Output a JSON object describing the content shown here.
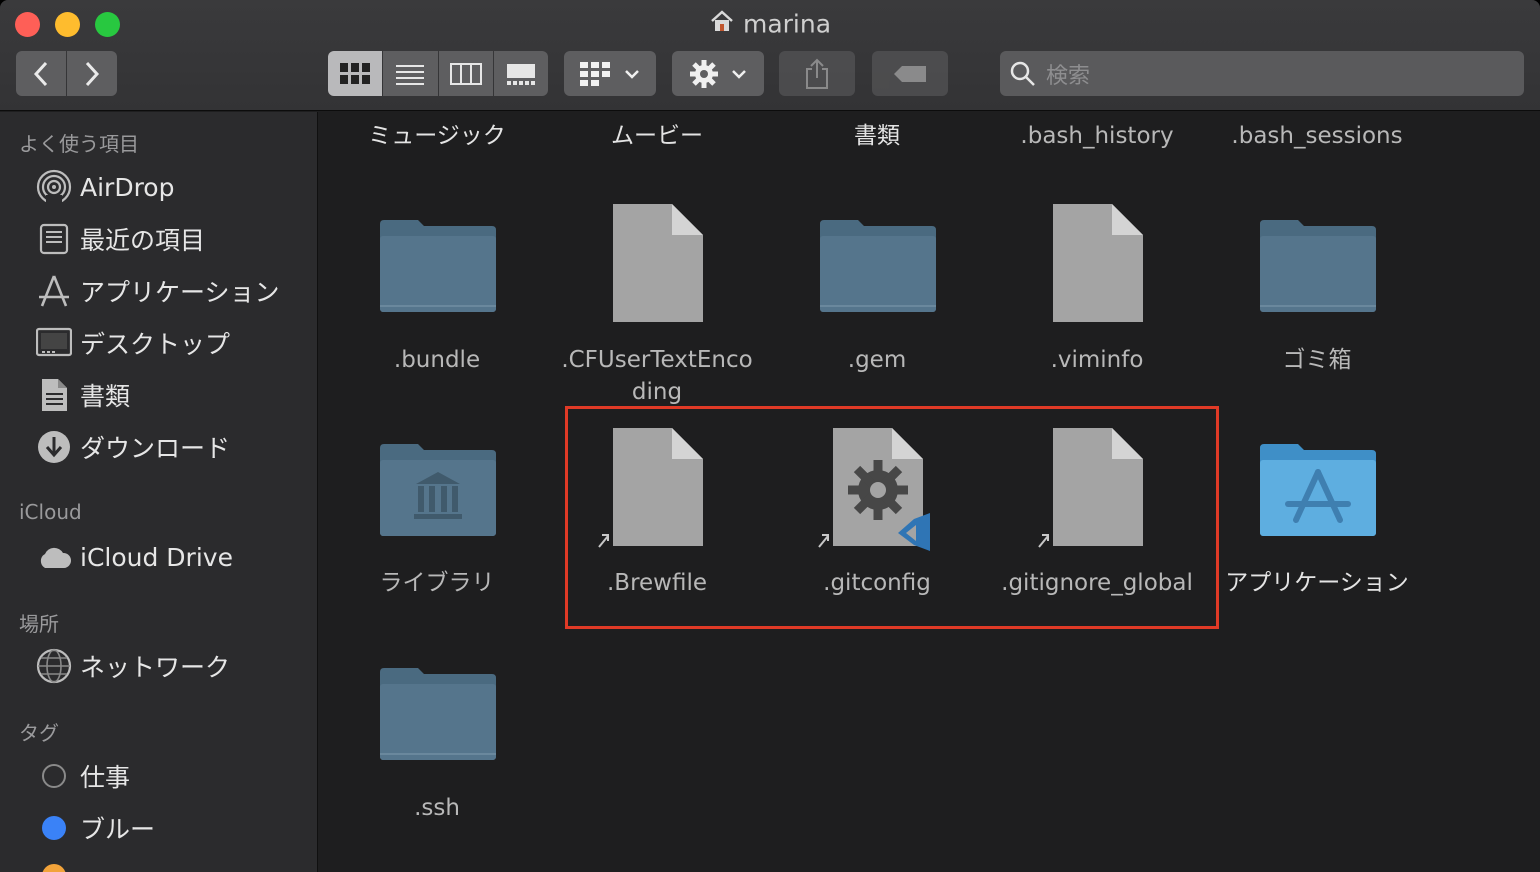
{
  "window": {
    "title": "marina"
  },
  "toolbar": {
    "search_placeholder": "検索"
  },
  "sidebar": {
    "favorites_heading": "よく使う項目",
    "favorites": [
      {
        "label": "AirDrop",
        "icon": "airdrop-icon"
      },
      {
        "label": "最近の項目",
        "icon": "recents-icon"
      },
      {
        "label": "アプリケーション",
        "icon": "applications-icon"
      },
      {
        "label": "デスクトップ",
        "icon": "desktop-icon"
      },
      {
        "label": "書類",
        "icon": "document-icon"
      },
      {
        "label": "ダウンロード",
        "icon": "download-icon"
      }
    ],
    "icloud_heading": "iCloud",
    "icloud": [
      {
        "label": "iCloud Drive",
        "icon": "cloud-icon"
      }
    ],
    "places_heading": "場所",
    "places": [
      {
        "label": "ネットワーク",
        "icon": "network-icon"
      }
    ],
    "tags_heading": "タグ",
    "tags": [
      {
        "label": "仕事",
        "color": "#2b2b2d"
      },
      {
        "label": "ブルー",
        "color": "#3a82f7"
      }
    ]
  },
  "files": {
    "row0": [
      "ミュージック",
      "ムービー",
      "書類",
      ".bash_history",
      ".bash_sessions"
    ],
    "row1": [
      ".bundle",
      ".CFUserTextEnco",
      "ding",
      ".gem",
      ".viminfo",
      "ゴミ箱"
    ],
    "row2": [
      "ライブラリ",
      ".Brewfile",
      ".gitconfig",
      ".gitignore_global",
      "アプリケーション"
    ],
    "row3": [
      ".ssh"
    ]
  },
  "colors": {
    "highlight": "#e03a26",
    "folder": "#4f6f86",
    "accent_blue": "#3a82f7"
  }
}
